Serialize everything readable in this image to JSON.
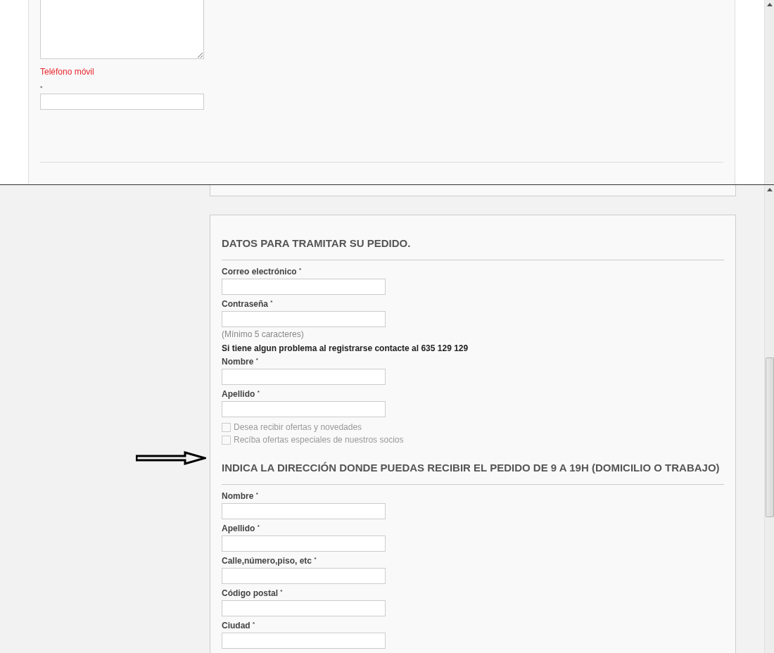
{
  "upper_form": {
    "fields": [
      {
        "kind": "textarea"
      },
      {
        "kind": "label",
        "text": "Teléfono móvil"
      },
      {
        "kind": "mark",
        "text": "*"
      },
      {
        "kind": "input"
      }
    ]
  },
  "order_section": {
    "title": "DATOS PARA TRAMITAR SU PEDIDO.",
    "items": [
      {
        "kind": "field",
        "label": "Correo electrónico",
        "required_mark": "*"
      },
      {
        "kind": "field",
        "label": "Contraseña",
        "required_mark": "*"
      },
      {
        "kind": "hint",
        "text": "(Mínimo 5 caracteres)"
      },
      {
        "kind": "notice",
        "text": "Si tiene algun problema al registrarse contacte al 635 129 129"
      },
      {
        "kind": "field",
        "label": "Nombre",
        "required_mark": "*"
      },
      {
        "kind": "field",
        "label": "Apellido",
        "required_mark": "*"
      },
      {
        "kind": "checkbox",
        "label": "Desea recibir ofertas y novedades",
        "checked": false
      },
      {
        "kind": "checkbox",
        "label": "Recíba ofertas especiales de nuestros socios",
        "checked": false
      }
    ]
  },
  "address_section": {
    "title": "INDICA LA DIRECCIÓN DONDE PUEDAS RECIBIR EL PEDIDO DE 9 A 19H (DOMICILIO O TRABAJO)",
    "items": [
      {
        "kind": "field",
        "label": "Nombre",
        "required_mark": "*"
      },
      {
        "kind": "field",
        "label": "Apellido",
        "required_mark": "*"
      },
      {
        "kind": "field",
        "label": "Calle,número,piso, etc",
        "required_mark": "*"
      },
      {
        "kind": "field",
        "label": "Código postal",
        "required_mark": "*"
      },
      {
        "kind": "field",
        "label": "Ciudad",
        "required_mark": "*"
      }
    ]
  }
}
